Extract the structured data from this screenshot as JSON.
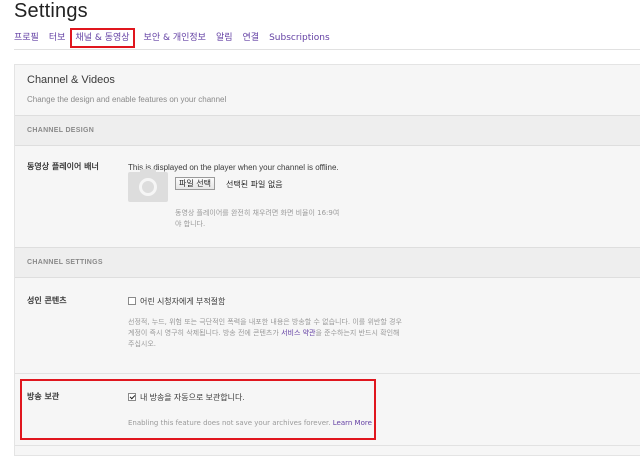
{
  "page": {
    "title": "Settings"
  },
  "tabs": [
    {
      "label": "프로필",
      "active": false
    },
    {
      "label": "터보",
      "active": false
    },
    {
      "label": "채널 & 동영상",
      "active": true
    },
    {
      "label": "보안 & 개인정보",
      "active": false
    },
    {
      "label": "알림",
      "active": false
    },
    {
      "label": "연결",
      "active": false
    },
    {
      "label": "Subscriptions",
      "active": false
    }
  ],
  "section": {
    "title": "Channel & Videos",
    "subtitle": "Change the design and enable features on your channel"
  },
  "channel_design": {
    "header": "CHANNEL DESIGN",
    "banner_label": "동영상 플레이어 배너",
    "banner_desc": "This is displayed on the player when your channel is offline.",
    "file_button": "파일 선택",
    "file_status": "선택된 파일 없음",
    "banner_hint_line1": "동영상 플레이어를 완전히 채우려면 화면 비율이 16:9여",
    "banner_hint_line2": "야 합니다."
  },
  "channel_settings": {
    "header": "CHANNEL SETTINGS",
    "mature_label": "성인 콘텐츠",
    "mature_checkbox_label": "어린 시청자에게 부적절함",
    "mature_checked": false,
    "mature_hint_line1": "선정적, 누드, 위험 또는 극단적인 폭력을 내포한 내용은 방송할 수 없습니다. 이를 위반할 경우",
    "mature_hint_line2": "계정이 즉시 영구히 삭제됩니다. 방송 전에 콘텐츠가",
    "mature_hint_link": "서비스 약관",
    "mature_hint_line2_end": "을 준수하는지 반드시 확인해",
    "mature_hint_line3": "주십시오.",
    "archive_label": "방송 보관",
    "archive_checkbox_label": "내 방송을 자동으로 보관합니다.",
    "archive_checked": true,
    "archive_hint": "Enabling this feature does not save your archives forever.",
    "archive_link": "Learn More"
  },
  "colors": {
    "accent": "#6441a4",
    "highlight": "#e0161e"
  }
}
